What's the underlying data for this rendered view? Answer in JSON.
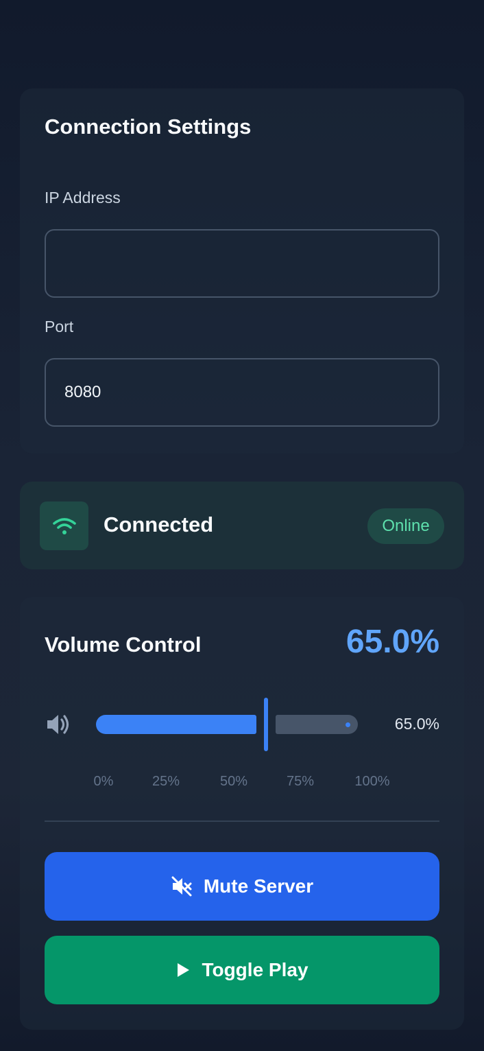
{
  "connection": {
    "title": "Connection Settings",
    "ip_label": "IP Address",
    "ip_value": "",
    "port_label": "Port",
    "port_value": "8080"
  },
  "status": {
    "icon": "wifi-icon",
    "text": "Connected",
    "badge": "Online"
  },
  "volume": {
    "title": "Volume Control",
    "value_display": "65.0%",
    "value_percent": 65.0,
    "slider_value_display": "65.0%",
    "ticks": [
      "0%",
      "25%",
      "50%",
      "75%",
      "100%"
    ],
    "speaker_icon": "speaker-icon"
  },
  "actions": {
    "mute_label": "Mute Server",
    "mute_icon": "mute-icon",
    "play_label": "Toggle Play",
    "play_icon": "play-icon"
  },
  "colors": {
    "accent": "#3b82f6",
    "success": "#059669",
    "primary_button": "#2563eb",
    "online_text": "#5ee0ad"
  }
}
